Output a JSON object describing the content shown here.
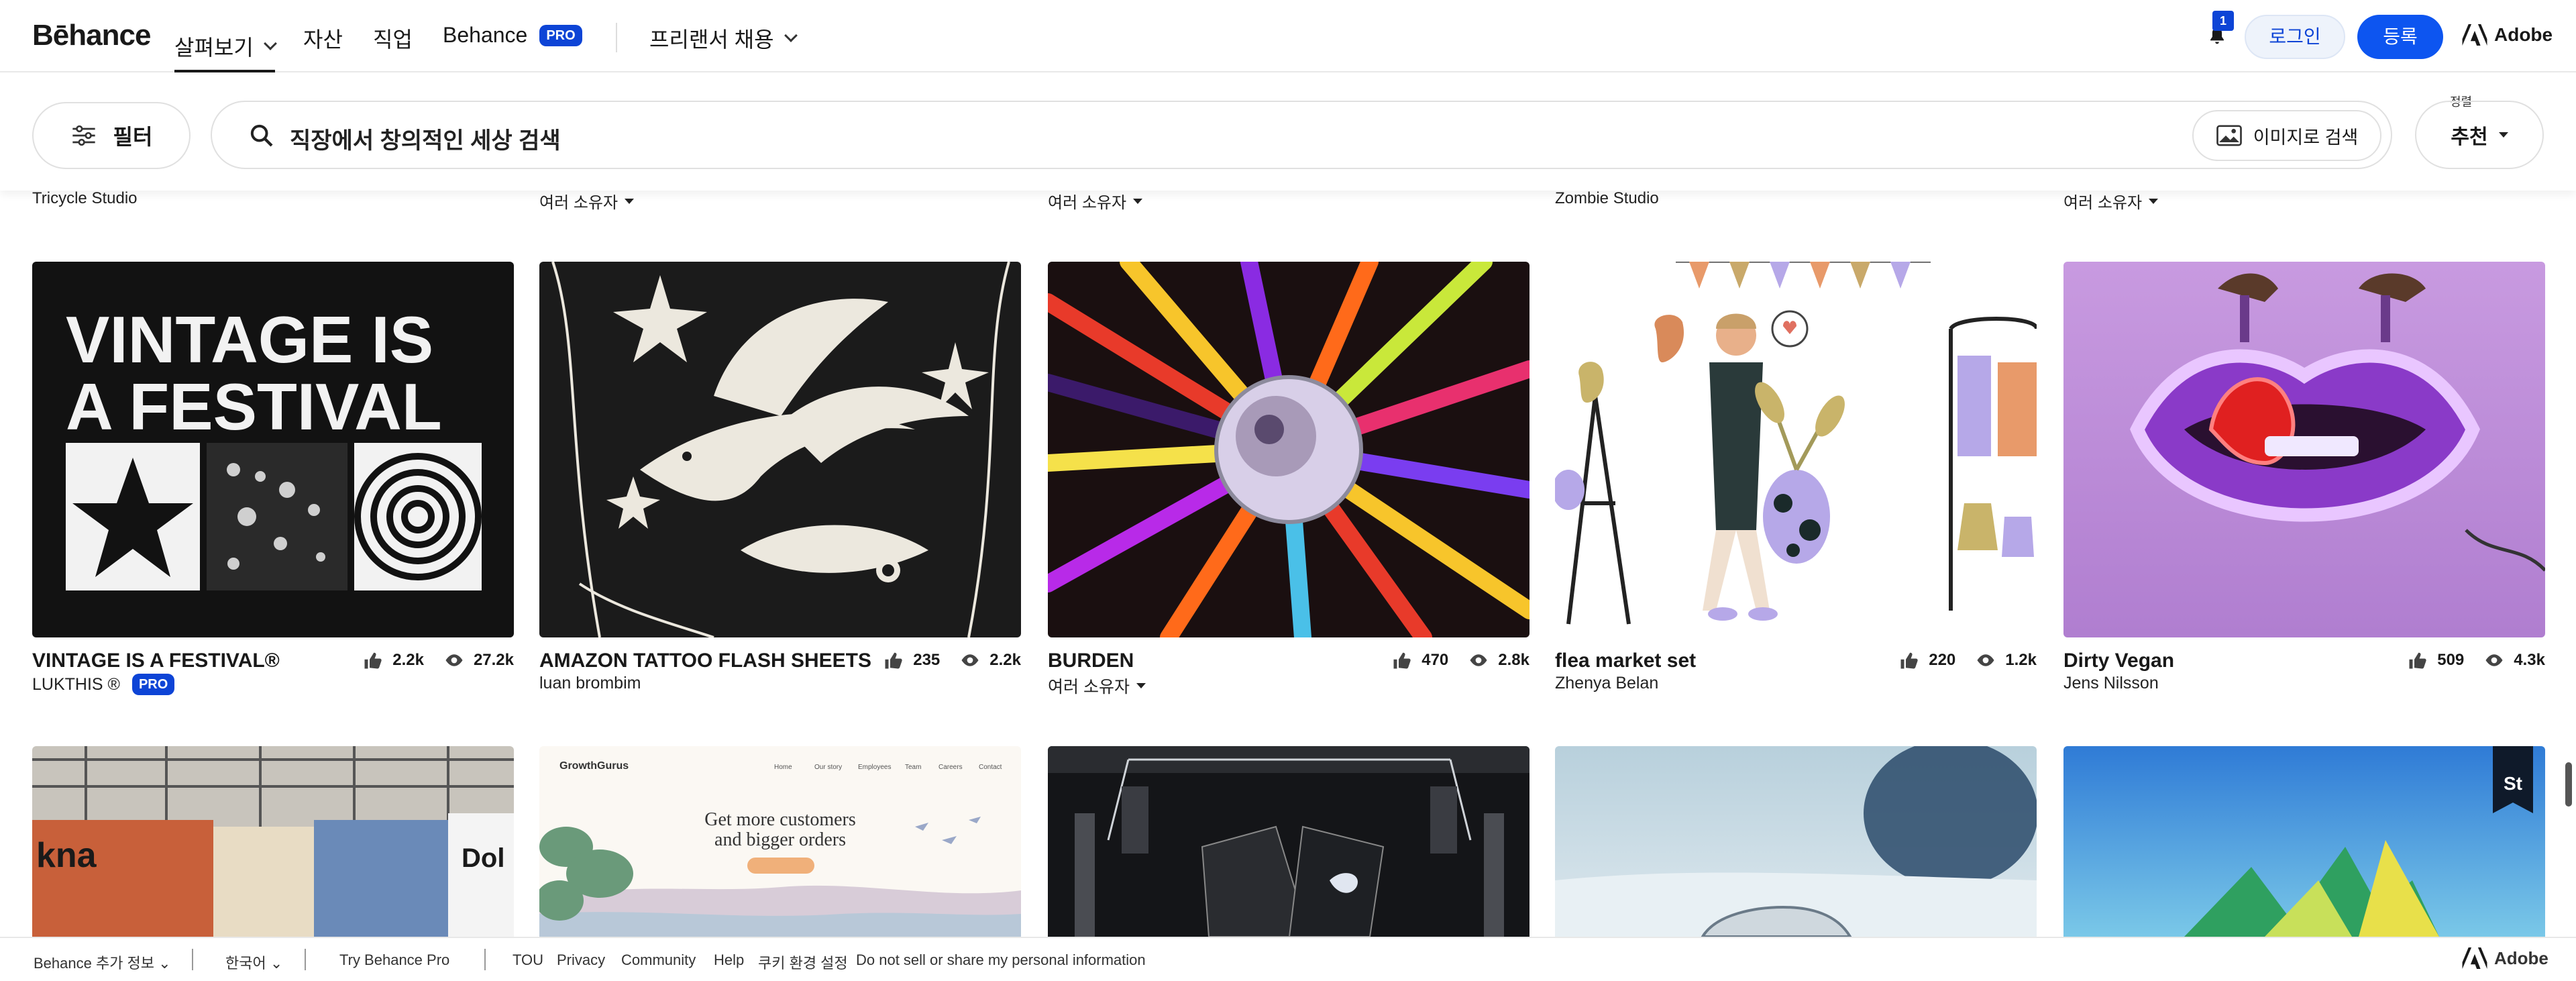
{
  "nav": {
    "logo": "Bēhance",
    "items": [
      "살펴보기",
      "자산",
      "직업",
      "Behance"
    ],
    "pro_badge": "PRO",
    "freelance": "프리랜서 채용",
    "notification_count": "1",
    "login": "로그인",
    "signup": "등록",
    "adobe": "Adobe"
  },
  "filterbar": {
    "filter_label": "필터",
    "search_placeholder": "직장에서 창의적인 세상 검색",
    "image_search": "이미지로 검색",
    "sort_label": "정렬",
    "sort_value": "추천"
  },
  "top_row_owners": [
    "Tricycle Studio",
    "여러 소유자",
    "여러 소유자",
    "Zombie Studio",
    "여러 소유자"
  ],
  "cards": [
    {
      "title": "VINTAGE IS A FESTIVAL®",
      "owner": "LUKTHIS ®",
      "pro": "PRO",
      "likes": "2.2k",
      "views": "27.2k",
      "image_text": [
        "VINTAGE IS",
        "A FESTIVAL"
      ]
    },
    {
      "title": "AMAZON TATTOO FLASH SHEETS",
      "owner": "luan brombim",
      "likes": "235",
      "views": "2.2k"
    },
    {
      "title": "BURDEN",
      "owner": "여러 소유자",
      "likes": "470",
      "views": "2.8k"
    },
    {
      "title": "flea market set",
      "owner": "Zhenya Belan",
      "likes": "220",
      "views": "1.2k"
    },
    {
      "title": "Dirty Vegan",
      "owner": "Jens Nilsson",
      "likes": "509",
      "views": "4.3k"
    }
  ],
  "row3": {
    "growth_logo": "GrowthGurus",
    "growth_nav": [
      "Home",
      "Our story",
      "Employees",
      "Team",
      "Careers",
      "Contact"
    ],
    "growth_headline": [
      "Get more customers",
      "and bigger orders"
    ],
    "poster_text": "kna",
    "dol": "Dol",
    "stock_badge": "St"
  },
  "footer": {
    "items": [
      "Behance 추가 정보",
      "한국어",
      "Try Behance Pro",
      "TOU",
      "Privacy",
      "Community",
      "Help",
      "쿠키 환경 설정",
      "Do not sell or share my personal information"
    ],
    "adobe": "Adobe"
  },
  "colors": {
    "accent": "#0d44d6",
    "signup": "#0d55f0"
  }
}
